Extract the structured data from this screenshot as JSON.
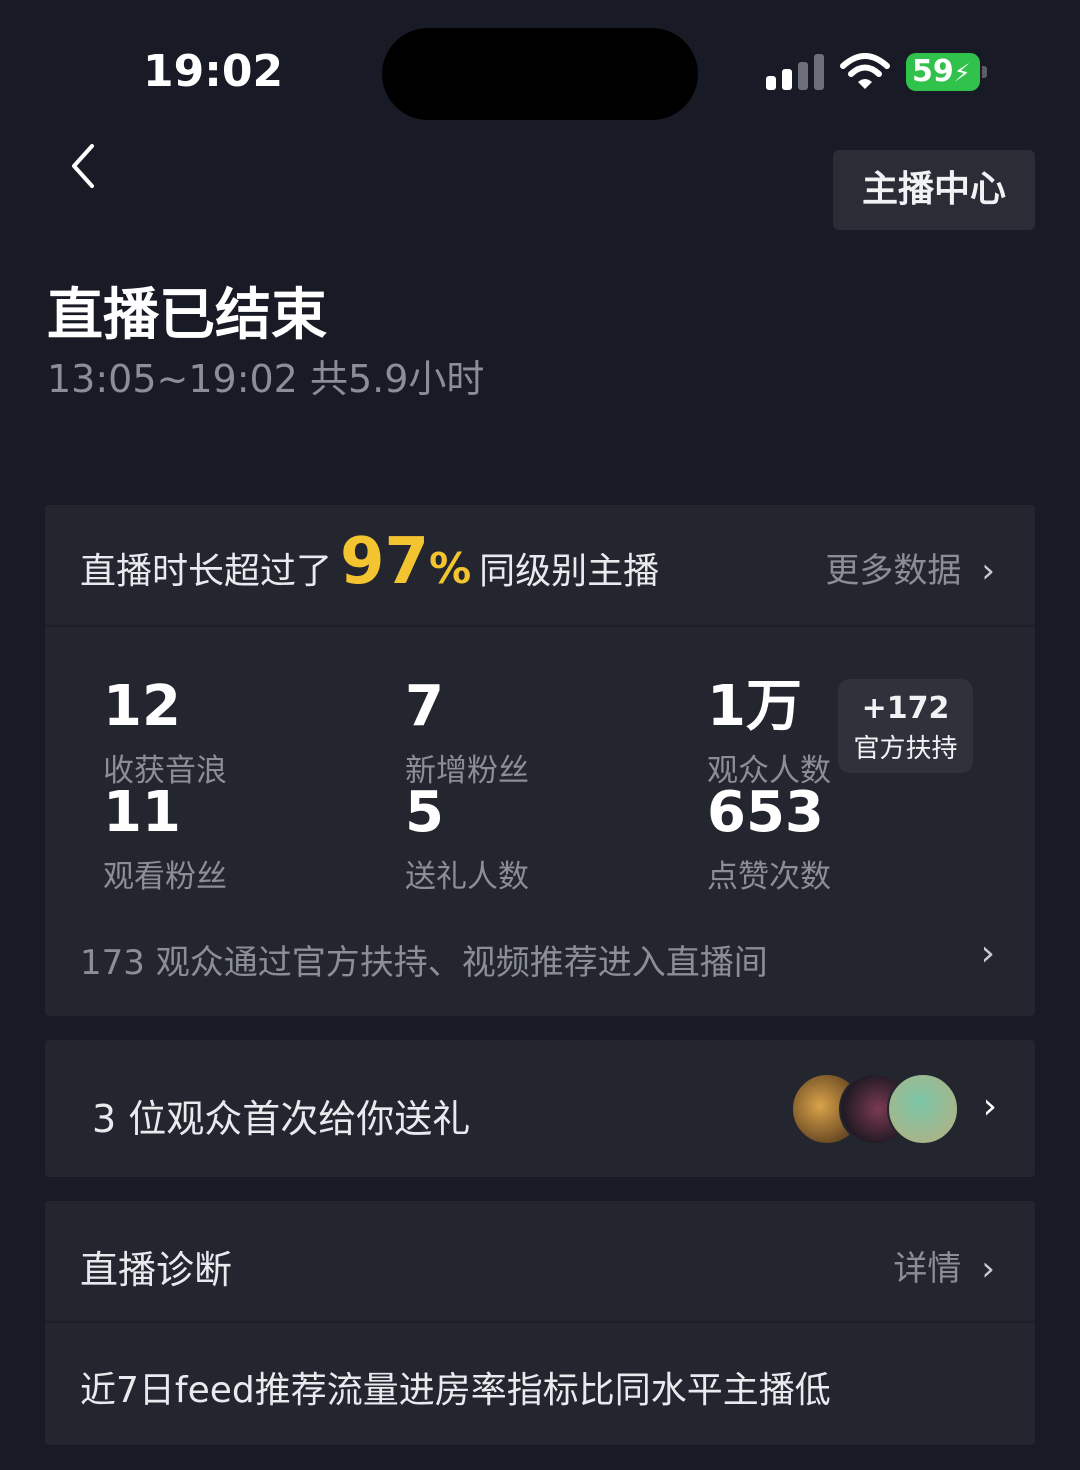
{
  "status_bar": {
    "time": "19:02",
    "battery": "59"
  },
  "header": {
    "back_icon": "chevron-left-icon",
    "anchor_center": "主播中心",
    "title": "直播已结束",
    "subtitle": "13:05~19:02 共5.9小时"
  },
  "summary": {
    "prefix": "直播时长超过了",
    "percent_value": "97",
    "percent_sign": "%",
    "suffix": "同级别主播",
    "more_label": "更多数据"
  },
  "stats": [
    {
      "value": "12",
      "label": "收获音浪"
    },
    {
      "value": "7",
      "label": "新增粉丝"
    },
    {
      "value": "1万",
      "label": "观众人数"
    },
    {
      "value": "11",
      "label": "观看粉丝"
    },
    {
      "value": "5",
      "label": "送礼人数"
    },
    {
      "value": "653",
      "label": "点赞次数"
    }
  ],
  "support_badge": {
    "count": "+172",
    "label": "官方扶持"
  },
  "entry_row": "173 观众通过官方扶持、视频推荐进入直播间",
  "gift": {
    "text": "3 位观众首次给你送礼"
  },
  "diagnosis": {
    "title": "直播诊断",
    "more_label": "详情",
    "item": "近7日feed推荐流量进房率指标比同水平主播低"
  },
  "colors": {
    "background": "#181b26",
    "card": "#23262f",
    "accent": "#f4c430",
    "battery": "#31c24b"
  }
}
